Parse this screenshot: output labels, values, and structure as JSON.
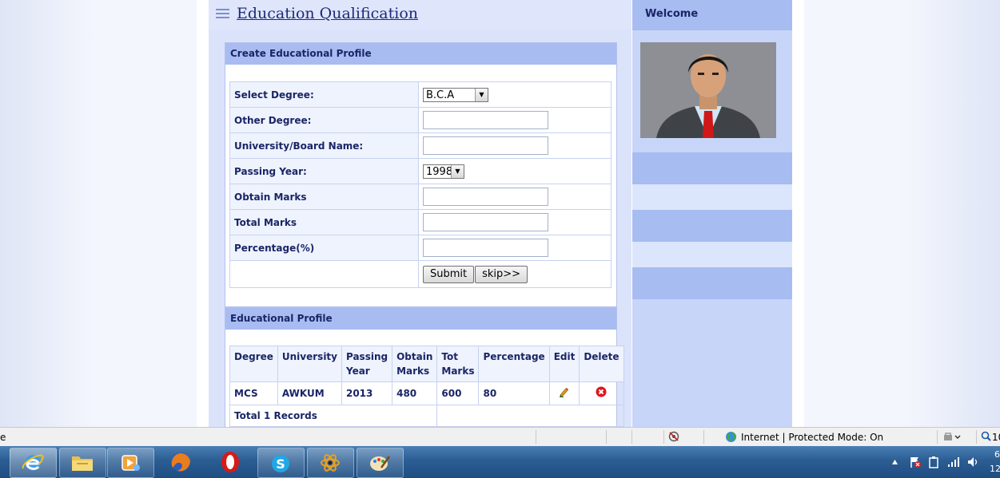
{
  "page": {
    "title": "Education Qualification"
  },
  "create_form": {
    "header": "Create Educational Profile",
    "fields": {
      "degree": {
        "label": "Select Degree:",
        "value": "B.C.A"
      },
      "other_degree": {
        "label": "Other Degree:",
        "value": ""
      },
      "university": {
        "label": "University/Board Name:",
        "value": ""
      },
      "passing_year": {
        "label": "Passing Year:",
        "value": "1998"
      },
      "obtain_marks": {
        "label": "Obtain Marks",
        "value": ""
      },
      "total_marks": {
        "label": "Total Marks",
        "value": ""
      },
      "percentage": {
        "label": "Percentage(%)",
        "value": ""
      }
    },
    "submit_label": "Submit",
    "skip_label": "skip>>"
  },
  "profile_list": {
    "header": "Educational Profile",
    "columns": [
      "Degree",
      "University",
      "Passing Year",
      "Obtain Marks",
      "Tot Marks",
      "Percentage",
      "Edit",
      "Delete"
    ],
    "rows": [
      {
        "degree": "MCS",
        "university": "AWKUM",
        "year": "2013",
        "obtained": "480",
        "total": "600",
        "percentage": "80"
      }
    ],
    "footer": "Total 1 Records"
  },
  "sidebar": {
    "welcome": "Welcome"
  },
  "statusbar": {
    "left_fragment": "e",
    "zone_text": "Internet | Protected Mode: On",
    "zoom_fragment": "10"
  },
  "taskbar": {
    "apps": [
      "internet-explorer",
      "windows-explorer",
      "media-player",
      "firefox",
      "opera",
      "skype",
      "atom-app",
      "paint"
    ],
    "clock_line1": "6",
    "clock_line2": "12"
  },
  "colors": {
    "header_band": "#a8bcf2",
    "label_text": "#1a2566",
    "delete_red": "#e0161b"
  }
}
